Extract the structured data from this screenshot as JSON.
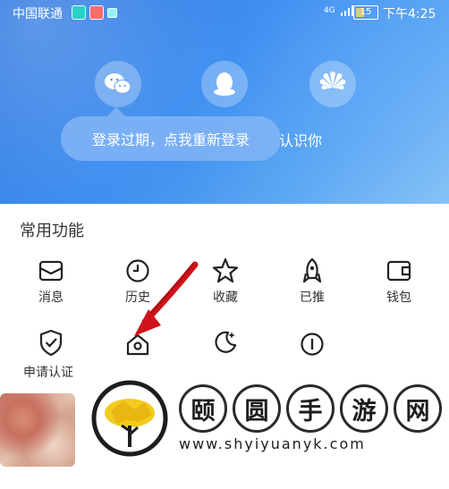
{
  "status_bar": {
    "carrier": "中国联通",
    "network": "4G",
    "battery": "15",
    "time": "下午4:25"
  },
  "login": {
    "icons": [
      "wechat-icon",
      "qq-icon",
      "huawei-icon"
    ],
    "tooltip": "登录过期，点我重新登录",
    "tooltip_tail": "认识你"
  },
  "functions": {
    "title": "常用功能",
    "row1": [
      {
        "label": "消息",
        "icon": "envelope-icon"
      },
      {
        "label": "历史",
        "icon": "clock-icon"
      },
      {
        "label": "收藏",
        "icon": "star-icon"
      },
      {
        "label": "已推",
        "icon": "rocket-icon"
      },
      {
        "label": "钱包",
        "icon": "wallet-icon"
      }
    ],
    "row2": [
      {
        "label": "申请认证",
        "icon": "shield-check-icon"
      },
      {
        "label": "",
        "icon": "home-icon"
      },
      {
        "label": "",
        "icon": "moon-icon"
      },
      {
        "label": "",
        "icon": "info-icon"
      }
    ]
  },
  "watermark": {
    "chars": [
      "颐",
      "圆",
      "手",
      "游",
      "网"
    ],
    "url": "www.shyiyuanyk.com"
  },
  "colors": {
    "header_start": "#2b74df",
    "header_end": "#89c5f5",
    "arrow": "#d1121a"
  }
}
